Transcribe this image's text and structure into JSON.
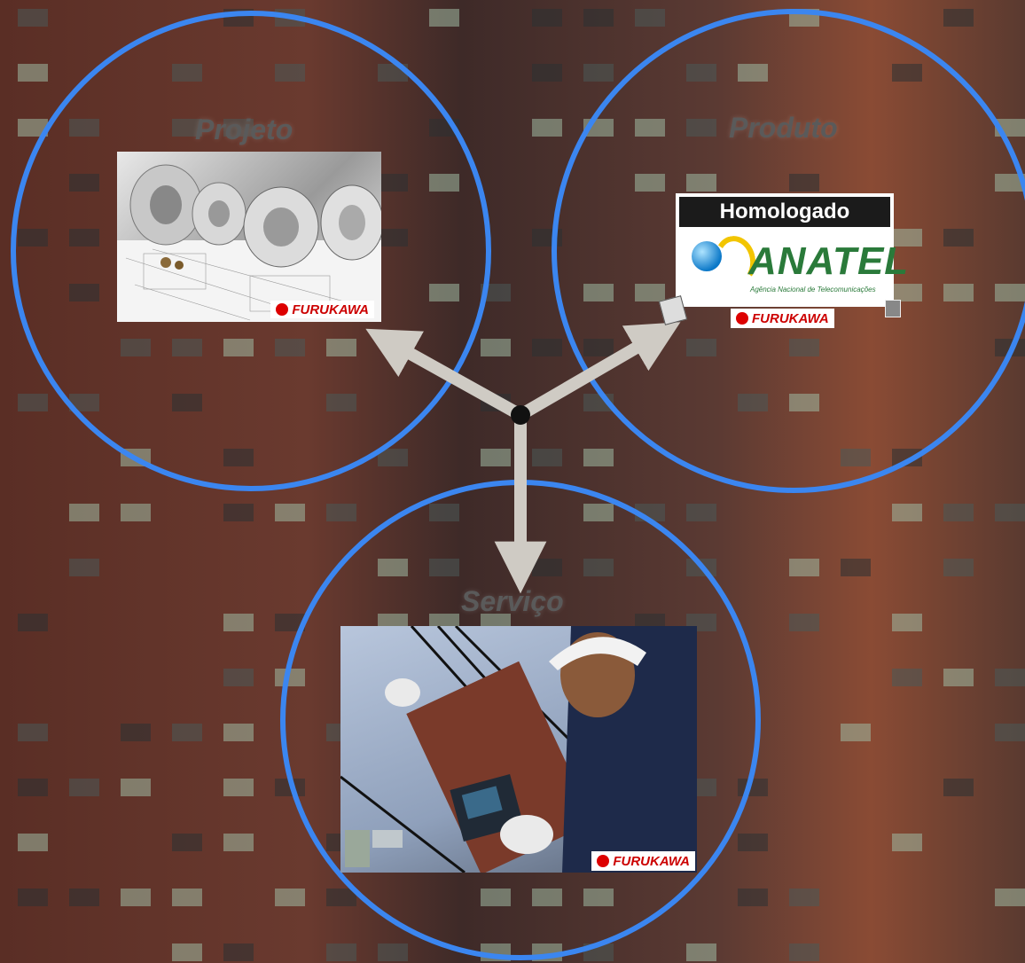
{
  "labels": {
    "projeto": "Projeto",
    "produto": "Produto",
    "servico": "Serviço"
  },
  "anatel": {
    "banner": "Homologado",
    "name": "ANATEL",
    "subtitle": "Agência Nacional de Telecomunicações"
  },
  "brand": "FURUKAWA",
  "colors": {
    "circle": "#3b86f0",
    "arrow": "#cfcbc4",
    "hub": "#111111"
  },
  "icons": [
    "furukawa-logo-icon",
    "anatel-logo-icon"
  ]
}
